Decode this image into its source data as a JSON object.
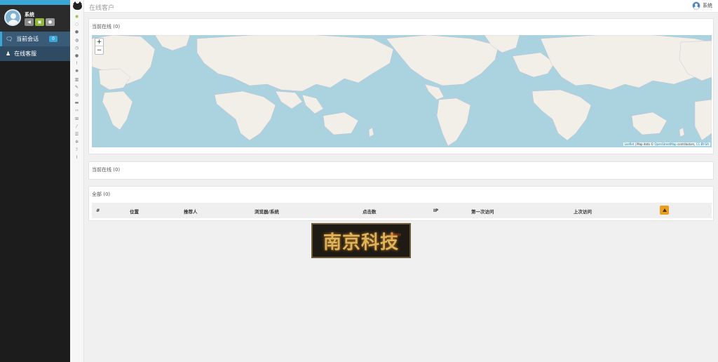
{
  "sidebar": {
    "username": "系统",
    "mini_buttons": [
      "volume-icon",
      "badge-icon",
      "chat-icon"
    ],
    "items": [
      {
        "label": "当前会话",
        "badge": "0",
        "icon": "chat-icon"
      },
      {
        "label": "在线客服",
        "icon": "user-icon"
      }
    ]
  },
  "rail_icons": [
    "eye-icon",
    "chat-icon",
    "comment-icon",
    "comments-icon",
    "clock-icon",
    "bubble-icon",
    "pin-icon",
    "gear-icon",
    "bank-icon",
    "pen-icon",
    "user-circle-icon",
    "mail-icon",
    "code-icon",
    "basket-icon",
    "brush-icon",
    "list-icon",
    "cog-icon",
    "wrench-icon",
    "chart-icon"
  ],
  "header": {
    "title": "在线客户",
    "user": "系统"
  },
  "panels": {
    "map_title": "当前在线 (0)",
    "online_title": "当前在线 (0)",
    "all_title": "全部 (0)"
  },
  "map": {
    "zoom_in": "+",
    "zoom_out": "−",
    "attribution_a": "Leaflet",
    "attribution_b": " | Map data © ",
    "attribution_c": "OpenStreetMap",
    "attribution_d": " contributors, ",
    "attribution_e": "CC-BY-SA"
  },
  "table": {
    "headers": [
      "#",
      "位置",
      "推荐人",
      "浏览器/系统",
      "点击数",
      "IP",
      "第一次访问",
      "上次访问"
    ]
  },
  "banner": {
    "text": "南京科技",
    "seal": "南京科技"
  },
  "colors": {
    "accent": "#3aa6d6",
    "sidebar": "#1c1c1c",
    "water": "#aad3df",
    "land": "#f2efe9",
    "warn": "#e8a020"
  }
}
